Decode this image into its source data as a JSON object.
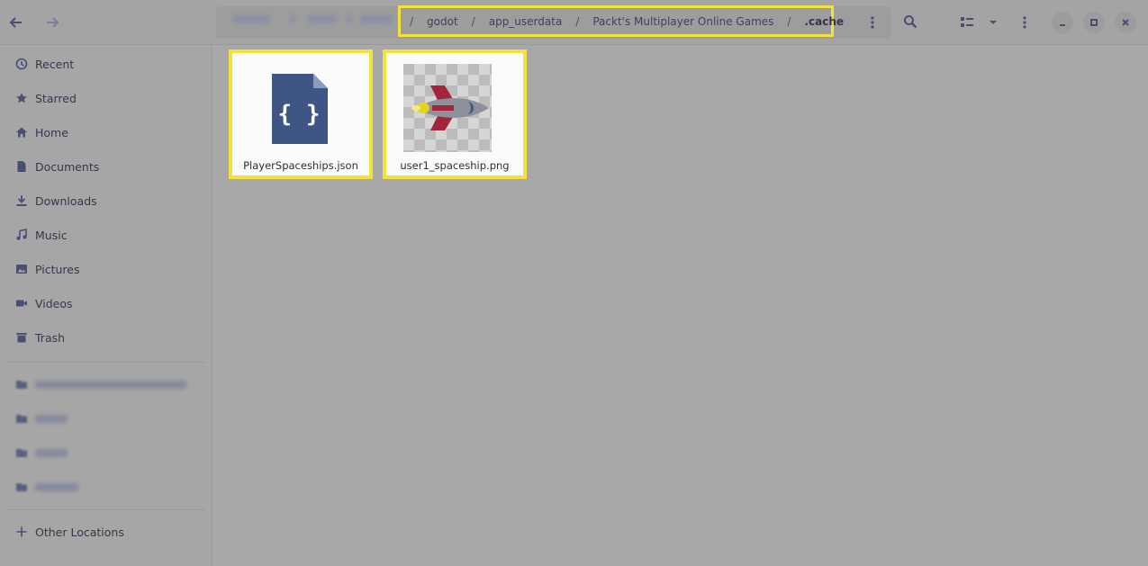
{
  "header": {
    "back_icon": "arrow-left-icon",
    "forward_icon": "arrow-right-icon",
    "path": [
      {
        "label": "godot"
      },
      {
        "label": "app_userdata"
      },
      {
        "label": "Packt's Multiplayer Online Games"
      },
      {
        "label": ".cache"
      }
    ],
    "separator": "/",
    "icons": [
      "more-vertical-icon",
      "search-icon",
      "view-list-icon",
      "chevron-down-icon",
      "menu-icon",
      "minimize-icon",
      "maximize-icon",
      "close-icon"
    ]
  },
  "sidebar": {
    "places": [
      {
        "label": "Recent",
        "icon": "clock-icon"
      },
      {
        "label": "Starred",
        "icon": "star-icon"
      },
      {
        "label": "Home",
        "icon": "home-icon"
      },
      {
        "label": "Documents",
        "icon": "document-icon"
      },
      {
        "label": "Downloads",
        "icon": "download-icon"
      },
      {
        "label": "Music",
        "icon": "music-icon"
      },
      {
        "label": "Pictures",
        "icon": "picture-icon"
      },
      {
        "label": "Videos",
        "icon": "video-icon"
      },
      {
        "label": "Trash",
        "icon": "trash-icon"
      }
    ],
    "other_locations": "Other Locations"
  },
  "files": [
    {
      "name": "PlayerSpaceships.json",
      "icon": "json-file-icon"
    },
    {
      "name": "user1_spaceship.png",
      "icon": "spaceship-thumbnail"
    }
  ],
  "colors": {
    "highlight": "#f2e23a",
    "icon_blue": "#3e5585",
    "background": "#a8a8a8"
  }
}
